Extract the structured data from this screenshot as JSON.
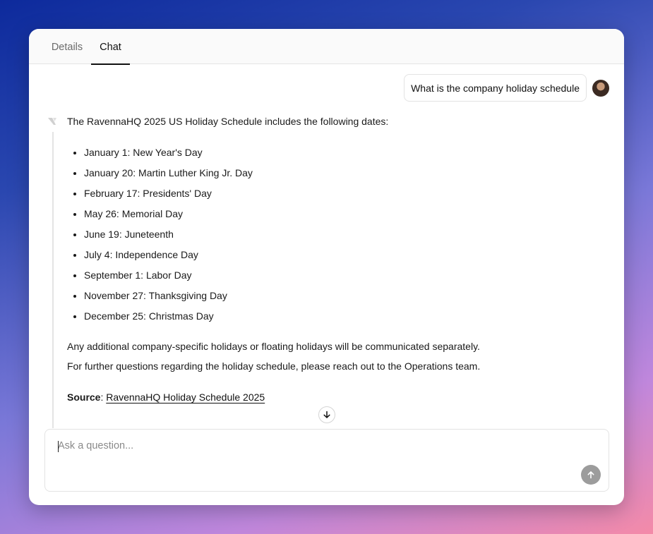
{
  "tabs": [
    {
      "label": "Details",
      "active": false
    },
    {
      "label": "Chat",
      "active": true
    }
  ],
  "user_message": "What is the company holiday schedule",
  "assistant": {
    "intro": "The RavennaHQ 2025 US Holiday Schedule includes the following dates:",
    "holidays": [
      "January 1: New Year's Day",
      "January 20: Martin Luther King Jr. Day",
      "February 17: Presidents' Day",
      "May 26: Memorial Day",
      "June 19: Juneteenth",
      "July 4: Independence Day",
      "September 1: Labor Day",
      "November 27: Thanksgiving Day",
      "December 25: Christmas Day"
    ],
    "para1": "Any additional company-specific holidays or floating holidays will be communicated separately.",
    "para2": "For further questions regarding the holiday schedule, please reach out to the Operations team.",
    "source_label": "Source",
    "source_sep": ": ",
    "source_link": "RavennaHQ Holiday Schedule 2025"
  },
  "input": {
    "placeholder": "Ask a question...",
    "value": ""
  },
  "icons": {
    "scroll": "arrow-down-icon",
    "send": "arrow-up-icon",
    "bot": "ravenna-logo-icon",
    "avatar": "user-avatar"
  },
  "colors": {
    "send_button": "#9c9c9c",
    "active_tab_underline": "#111111"
  }
}
